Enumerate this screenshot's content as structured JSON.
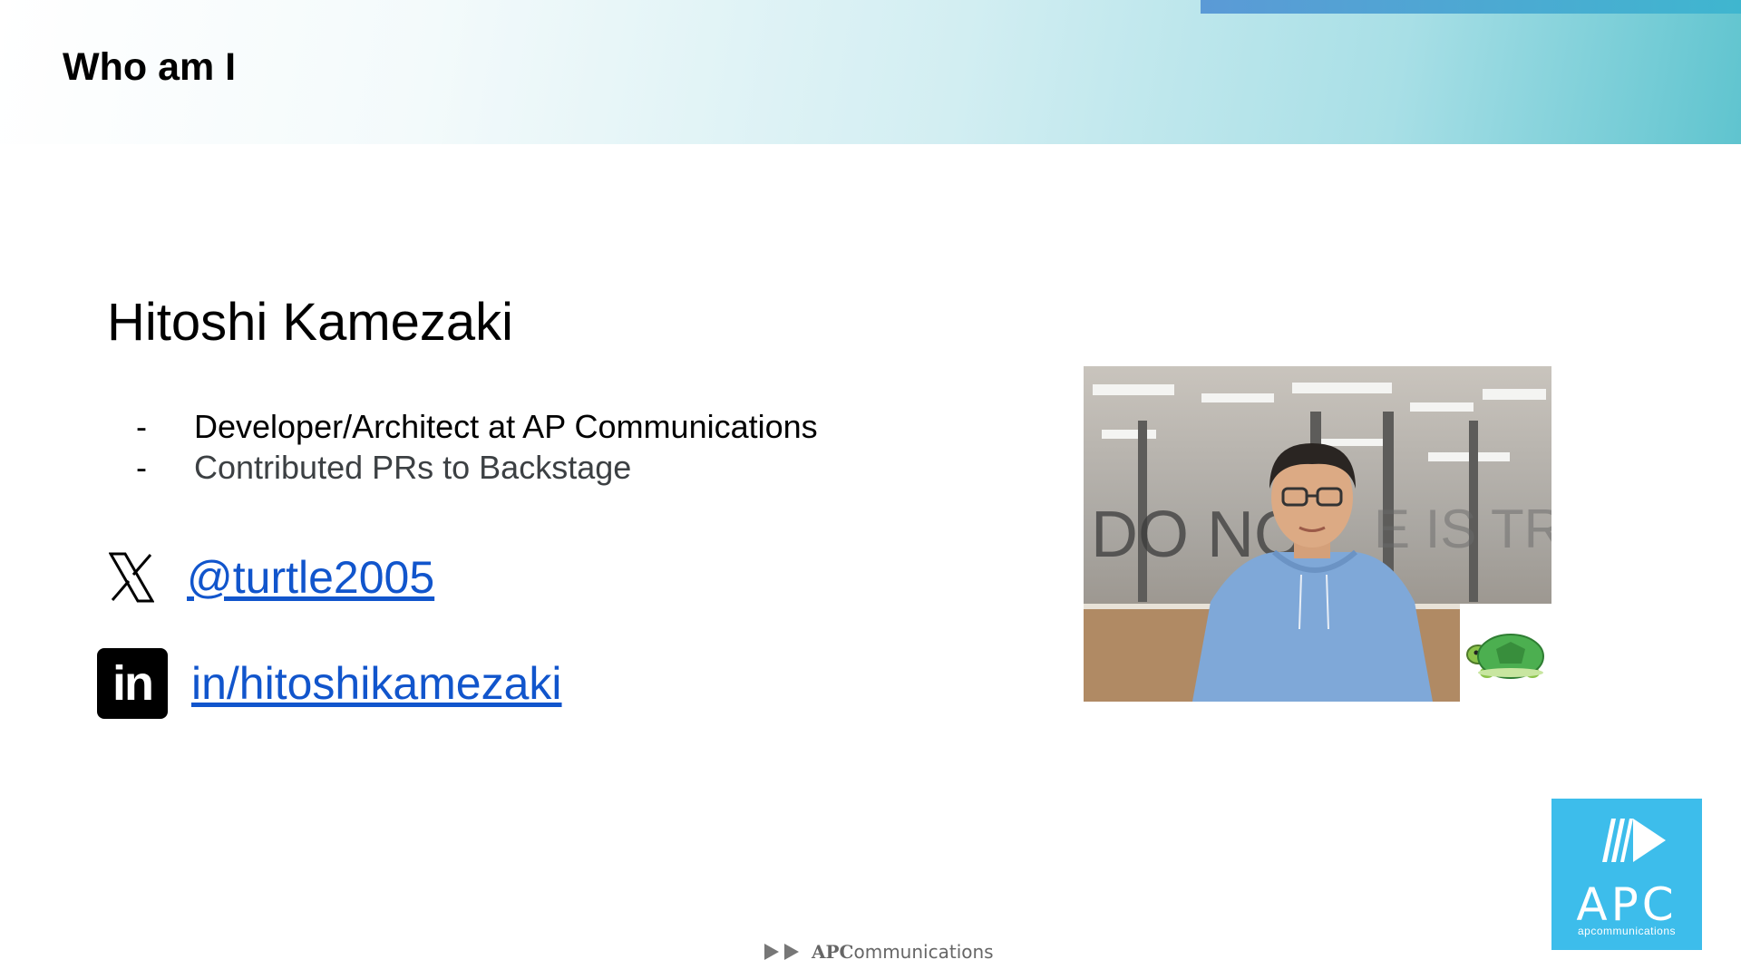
{
  "slide": {
    "title": "Who am I",
    "name": "Hitoshi Kamezaki",
    "bullets": [
      {
        "marker": "-",
        "text": "Developer/Architect at AP Communications"
      },
      {
        "marker": "-",
        "text": "Contributed PRs to Backstage"
      }
    ],
    "social": {
      "x": {
        "icon": "x-logo-icon",
        "handle": "@turtle2005"
      },
      "linkedin": {
        "icon": "linkedin-logo-icon",
        "icon_text": "in",
        "handle": "in/hitoshikamezaki"
      }
    }
  },
  "logos": {
    "corner_logo_text": "APC",
    "corner_logo_subtext": "apcommunications",
    "footer_logo_prefix": "APC",
    "footer_logo_suffix": "ommunications"
  },
  "colors": {
    "link": "#1155cc",
    "apc_blue": "#3dbdeb",
    "header_gradient_end": "#5fc4cf"
  }
}
